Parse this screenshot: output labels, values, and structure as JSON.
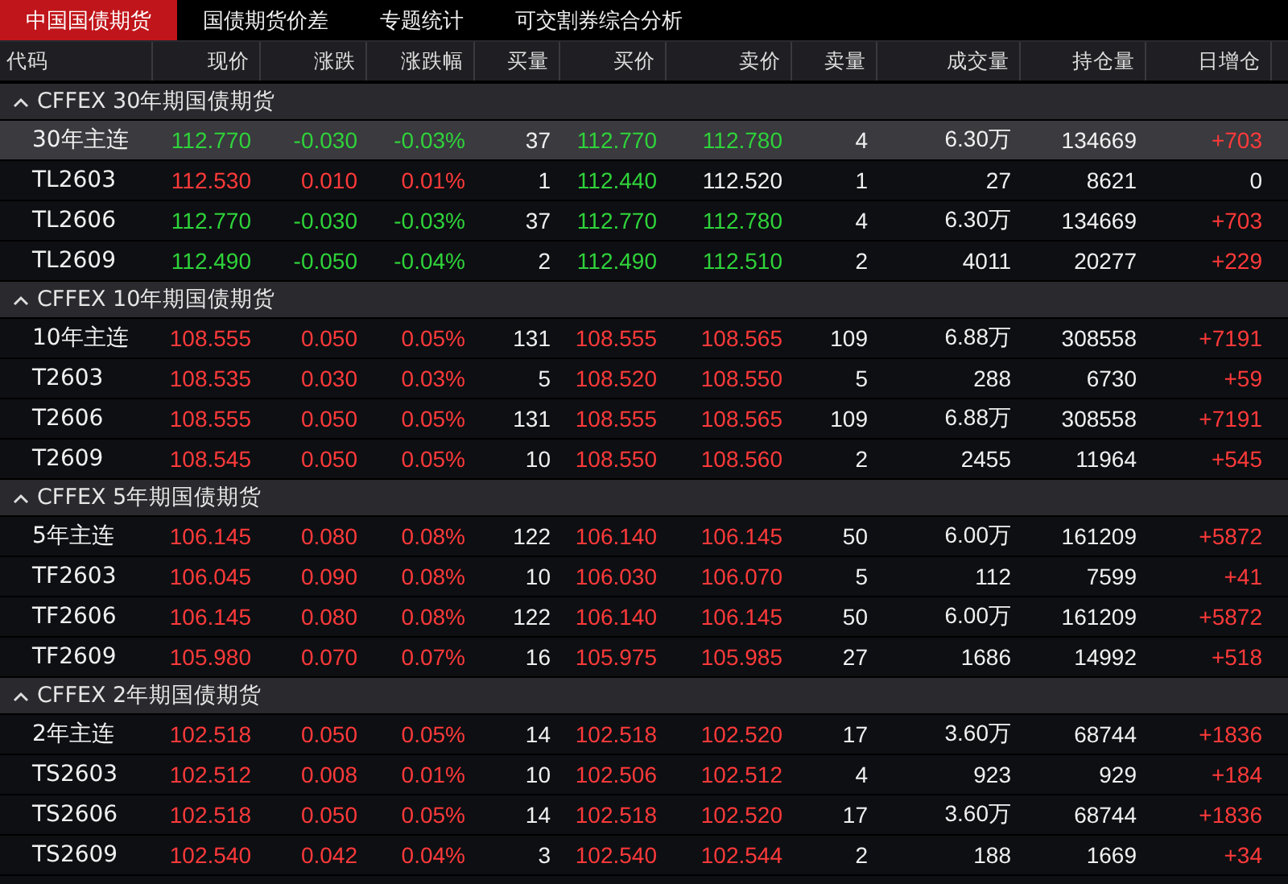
{
  "tabs": [
    {
      "label": "中国国债期货",
      "selected": true
    },
    {
      "label": "国债期货价差",
      "selected": false
    },
    {
      "label": "专题统计",
      "selected": false
    },
    {
      "label": "可交割券综合分析",
      "selected": false
    }
  ],
  "table": {
    "columns": [
      "代码",
      "现价",
      "涨跌",
      "涨跌幅",
      "买量",
      "买价",
      "卖价",
      "卖量",
      "成交量",
      "持仓量",
      "日增仓"
    ],
    "groups": [
      {
        "title": "CFFEX 30年期国债期货",
        "expanded": true,
        "rows": [
          {
            "selected": true,
            "cells": [
              {
                "text": "30年主连",
                "color": "#f0f0f0"
              },
              {
                "text": "112.770",
                "color": "#2fd33a"
              },
              {
                "text": "-0.030",
                "color": "#2fd33a"
              },
              {
                "text": "-0.03%",
                "color": "#2fd33a"
              },
              {
                "text": "37",
                "color": "#f0f0f0"
              },
              {
                "text": "112.770",
                "color": "#2fd33a"
              },
              {
                "text": "112.780",
                "color": "#2fd33a"
              },
              {
                "text": "4",
                "color": "#f0f0f0"
              },
              {
                "text": "6.30万",
                "color": "#f0f0f0"
              },
              {
                "text": "134669",
                "color": "#f0f0f0"
              },
              {
                "text": "+703",
                "color": "#ff3a3a"
              }
            ]
          },
          {
            "selected": false,
            "cells": [
              {
                "text": "TL2603",
                "color": "#f0f0f0"
              },
              {
                "text": "112.530",
                "color": "#ff3a3a"
              },
              {
                "text": "0.010",
                "color": "#ff3a3a"
              },
              {
                "text": "0.01%",
                "color": "#ff3a3a"
              },
              {
                "text": "1",
                "color": "#f0f0f0"
              },
              {
                "text": "112.440",
                "color": "#2fd33a"
              },
              {
                "text": "112.520",
                "color": "#f0f0f0"
              },
              {
                "text": "1",
                "color": "#f0f0f0"
              },
              {
                "text": "27",
                "color": "#f0f0f0"
              },
              {
                "text": "8621",
                "color": "#f0f0f0"
              },
              {
                "text": "0",
                "color": "#f0f0f0"
              }
            ]
          },
          {
            "selected": false,
            "cells": [
              {
                "text": "TL2606",
                "color": "#f0f0f0"
              },
              {
                "text": "112.770",
                "color": "#2fd33a"
              },
              {
                "text": "-0.030",
                "color": "#2fd33a"
              },
              {
                "text": "-0.03%",
                "color": "#2fd33a"
              },
              {
                "text": "37",
                "color": "#f0f0f0"
              },
              {
                "text": "112.770",
                "color": "#2fd33a"
              },
              {
                "text": "112.780",
                "color": "#2fd33a"
              },
              {
                "text": "4",
                "color": "#f0f0f0"
              },
              {
                "text": "6.30万",
                "color": "#f0f0f0"
              },
              {
                "text": "134669",
                "color": "#f0f0f0"
              },
              {
                "text": "+703",
                "color": "#ff3a3a"
              }
            ]
          },
          {
            "selected": false,
            "cells": [
              {
                "text": "TL2609",
                "color": "#f0f0f0"
              },
              {
                "text": "112.490",
                "color": "#2fd33a"
              },
              {
                "text": "-0.050",
                "color": "#2fd33a"
              },
              {
                "text": "-0.04%",
                "color": "#2fd33a"
              },
              {
                "text": "2",
                "color": "#f0f0f0"
              },
              {
                "text": "112.490",
                "color": "#2fd33a"
              },
              {
                "text": "112.510",
                "color": "#2fd33a"
              },
              {
                "text": "2",
                "color": "#f0f0f0"
              },
              {
                "text": "4011",
                "color": "#f0f0f0"
              },
              {
                "text": "20277",
                "color": "#f0f0f0"
              },
              {
                "text": "+229",
                "color": "#ff3a3a"
              }
            ]
          }
        ]
      },
      {
        "title": "CFFEX 10年期国债期货",
        "expanded": true,
        "rows": [
          {
            "selected": false,
            "cells": [
              {
                "text": "10年主连",
                "color": "#f0f0f0"
              },
              {
                "text": "108.555",
                "color": "#ff3a3a"
              },
              {
                "text": "0.050",
                "color": "#ff3a3a"
              },
              {
                "text": "0.05%",
                "color": "#ff3a3a"
              },
              {
                "text": "131",
                "color": "#f0f0f0"
              },
              {
                "text": "108.555",
                "color": "#ff3a3a"
              },
              {
                "text": "108.565",
                "color": "#ff3a3a"
              },
              {
                "text": "109",
                "color": "#f0f0f0"
              },
              {
                "text": "6.88万",
                "color": "#f0f0f0"
              },
              {
                "text": "308558",
                "color": "#f0f0f0"
              },
              {
                "text": "+7191",
                "color": "#ff3a3a"
              }
            ]
          },
          {
            "selected": false,
            "cells": [
              {
                "text": "T2603",
                "color": "#f0f0f0"
              },
              {
                "text": "108.535",
                "color": "#ff3a3a"
              },
              {
                "text": "0.030",
                "color": "#ff3a3a"
              },
              {
                "text": "0.03%",
                "color": "#ff3a3a"
              },
              {
                "text": "5",
                "color": "#f0f0f0"
              },
              {
                "text": "108.520",
                "color": "#ff3a3a"
              },
              {
                "text": "108.550",
                "color": "#ff3a3a"
              },
              {
                "text": "5",
                "color": "#f0f0f0"
              },
              {
                "text": "288",
                "color": "#f0f0f0"
              },
              {
                "text": "6730",
                "color": "#f0f0f0"
              },
              {
                "text": "+59",
                "color": "#ff3a3a"
              }
            ]
          },
          {
            "selected": false,
            "cells": [
              {
                "text": "T2606",
                "color": "#f0f0f0"
              },
              {
                "text": "108.555",
                "color": "#ff3a3a"
              },
              {
                "text": "0.050",
                "color": "#ff3a3a"
              },
              {
                "text": "0.05%",
                "color": "#ff3a3a"
              },
              {
                "text": "131",
                "color": "#f0f0f0"
              },
              {
                "text": "108.555",
                "color": "#ff3a3a"
              },
              {
                "text": "108.565",
                "color": "#ff3a3a"
              },
              {
                "text": "109",
                "color": "#f0f0f0"
              },
              {
                "text": "6.88万",
                "color": "#f0f0f0"
              },
              {
                "text": "308558",
                "color": "#f0f0f0"
              },
              {
                "text": "+7191",
                "color": "#ff3a3a"
              }
            ]
          },
          {
            "selected": false,
            "cells": [
              {
                "text": "T2609",
                "color": "#f0f0f0"
              },
              {
                "text": "108.545",
                "color": "#ff3a3a"
              },
              {
                "text": "0.050",
                "color": "#ff3a3a"
              },
              {
                "text": "0.05%",
                "color": "#ff3a3a"
              },
              {
                "text": "10",
                "color": "#f0f0f0"
              },
              {
                "text": "108.550",
                "color": "#ff3a3a"
              },
              {
                "text": "108.560",
                "color": "#ff3a3a"
              },
              {
                "text": "2",
                "color": "#f0f0f0"
              },
              {
                "text": "2455",
                "color": "#f0f0f0"
              },
              {
                "text": "11964",
                "color": "#f0f0f0"
              },
              {
                "text": "+545",
                "color": "#ff3a3a"
              }
            ]
          }
        ]
      },
      {
        "title": "CFFEX 5年期国债期货",
        "expanded": true,
        "rows": [
          {
            "selected": false,
            "cells": [
              {
                "text": "5年主连",
                "color": "#f0f0f0"
              },
              {
                "text": "106.145",
                "color": "#ff3a3a"
              },
              {
                "text": "0.080",
                "color": "#ff3a3a"
              },
              {
                "text": "0.08%",
                "color": "#ff3a3a"
              },
              {
                "text": "122",
                "color": "#f0f0f0"
              },
              {
                "text": "106.140",
                "color": "#ff3a3a"
              },
              {
                "text": "106.145",
                "color": "#ff3a3a"
              },
              {
                "text": "50",
                "color": "#f0f0f0"
              },
              {
                "text": "6.00万",
                "color": "#f0f0f0"
              },
              {
                "text": "161209",
                "color": "#f0f0f0"
              },
              {
                "text": "+5872",
                "color": "#ff3a3a"
              }
            ]
          },
          {
            "selected": false,
            "cells": [
              {
                "text": "TF2603",
                "color": "#f0f0f0"
              },
              {
                "text": "106.045",
                "color": "#ff3a3a"
              },
              {
                "text": "0.090",
                "color": "#ff3a3a"
              },
              {
                "text": "0.08%",
                "color": "#ff3a3a"
              },
              {
                "text": "10",
                "color": "#f0f0f0"
              },
              {
                "text": "106.030",
                "color": "#ff3a3a"
              },
              {
                "text": "106.070",
                "color": "#ff3a3a"
              },
              {
                "text": "5",
                "color": "#f0f0f0"
              },
              {
                "text": "112",
                "color": "#f0f0f0"
              },
              {
                "text": "7599",
                "color": "#f0f0f0"
              },
              {
                "text": "+41",
                "color": "#ff3a3a"
              }
            ]
          },
          {
            "selected": false,
            "cells": [
              {
                "text": "TF2606",
                "color": "#f0f0f0"
              },
              {
                "text": "106.145",
                "color": "#ff3a3a"
              },
              {
                "text": "0.080",
                "color": "#ff3a3a"
              },
              {
                "text": "0.08%",
                "color": "#ff3a3a"
              },
              {
                "text": "122",
                "color": "#f0f0f0"
              },
              {
                "text": "106.140",
                "color": "#ff3a3a"
              },
              {
                "text": "106.145",
                "color": "#ff3a3a"
              },
              {
                "text": "50",
                "color": "#f0f0f0"
              },
              {
                "text": "6.00万",
                "color": "#f0f0f0"
              },
              {
                "text": "161209",
                "color": "#f0f0f0"
              },
              {
                "text": "+5872",
                "color": "#ff3a3a"
              }
            ]
          },
          {
            "selected": false,
            "cells": [
              {
                "text": "TF2609",
                "color": "#f0f0f0"
              },
              {
                "text": "105.980",
                "color": "#ff3a3a"
              },
              {
                "text": "0.070",
                "color": "#ff3a3a"
              },
              {
                "text": "0.07%",
                "color": "#ff3a3a"
              },
              {
                "text": "16",
                "color": "#f0f0f0"
              },
              {
                "text": "105.975",
                "color": "#ff3a3a"
              },
              {
                "text": "105.985",
                "color": "#ff3a3a"
              },
              {
                "text": "27",
                "color": "#f0f0f0"
              },
              {
                "text": "1686",
                "color": "#f0f0f0"
              },
              {
                "text": "14992",
                "color": "#f0f0f0"
              },
              {
                "text": "+518",
                "color": "#ff3a3a"
              }
            ]
          }
        ]
      },
      {
        "title": "CFFEX 2年期国债期货",
        "expanded": true,
        "rows": [
          {
            "selected": false,
            "cells": [
              {
                "text": "2年主连",
                "color": "#f0f0f0"
              },
              {
                "text": "102.518",
                "color": "#ff3a3a"
              },
              {
                "text": "0.050",
                "color": "#ff3a3a"
              },
              {
                "text": "0.05%",
                "color": "#ff3a3a"
              },
              {
                "text": "14",
                "color": "#f0f0f0"
              },
              {
                "text": "102.518",
                "color": "#ff3a3a"
              },
              {
                "text": "102.520",
                "color": "#ff3a3a"
              },
              {
                "text": "17",
                "color": "#f0f0f0"
              },
              {
                "text": "3.60万",
                "color": "#f0f0f0"
              },
              {
                "text": "68744",
                "color": "#f0f0f0"
              },
              {
                "text": "+1836",
                "color": "#ff3a3a"
              }
            ]
          },
          {
            "selected": false,
            "cells": [
              {
                "text": "TS2603",
                "color": "#f0f0f0"
              },
              {
                "text": "102.512",
                "color": "#ff3a3a"
              },
              {
                "text": "0.008",
                "color": "#ff3a3a"
              },
              {
                "text": "0.01%",
                "color": "#ff3a3a"
              },
              {
                "text": "10",
                "color": "#f0f0f0"
              },
              {
                "text": "102.506",
                "color": "#ff3a3a"
              },
              {
                "text": "102.512",
                "color": "#ff3a3a"
              },
              {
                "text": "4",
                "color": "#f0f0f0"
              },
              {
                "text": "923",
                "color": "#f0f0f0"
              },
              {
                "text": "929",
                "color": "#f0f0f0"
              },
              {
                "text": "+184",
                "color": "#ff3a3a"
              }
            ]
          },
          {
            "selected": false,
            "cells": [
              {
                "text": "TS2606",
                "color": "#f0f0f0"
              },
              {
                "text": "102.518",
                "color": "#ff3a3a"
              },
              {
                "text": "0.050",
                "color": "#ff3a3a"
              },
              {
                "text": "0.05%",
                "color": "#ff3a3a"
              },
              {
                "text": "14",
                "color": "#f0f0f0"
              },
              {
                "text": "102.518",
                "color": "#ff3a3a"
              },
              {
                "text": "102.520",
                "color": "#ff3a3a"
              },
              {
                "text": "17",
                "color": "#f0f0f0"
              },
              {
                "text": "3.60万",
                "color": "#f0f0f0"
              },
              {
                "text": "68744",
                "color": "#f0f0f0"
              },
              {
                "text": "+1836",
                "color": "#ff3a3a"
              }
            ]
          },
          {
            "selected": false,
            "cells": [
              {
                "text": "TS2609",
                "color": "#f0f0f0"
              },
              {
                "text": "102.540",
                "color": "#ff3a3a"
              },
              {
                "text": "0.042",
                "color": "#ff3a3a"
              },
              {
                "text": "0.04%",
                "color": "#ff3a3a"
              },
              {
                "text": "3",
                "color": "#f0f0f0"
              },
              {
                "text": "102.540",
                "color": "#ff3a3a"
              },
              {
                "text": "102.544",
                "color": "#ff3a3a"
              },
              {
                "text": "2",
                "color": "#f0f0f0"
              },
              {
                "text": "188",
                "color": "#f0f0f0"
              },
              {
                "text": "1669",
                "color": "#f0f0f0"
              },
              {
                "text": "+34",
                "color": "#ff3a3a"
              }
            ]
          }
        ]
      }
    ]
  }
}
